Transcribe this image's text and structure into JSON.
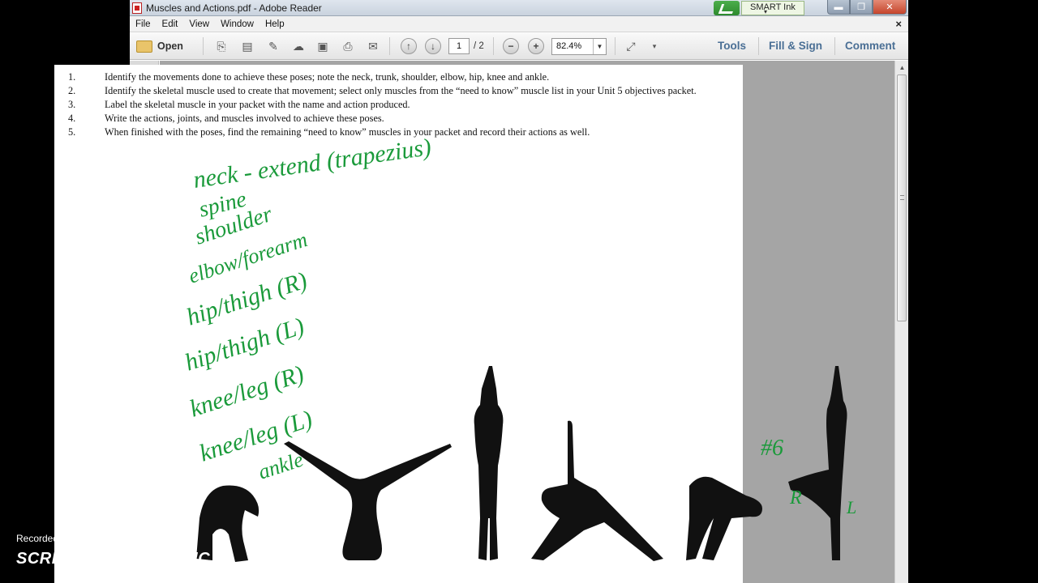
{
  "window": {
    "title": "Muscles and Actions.pdf - Adobe Reader",
    "smart_ink": "SMART Ink",
    "buttons": {
      "minimize": "▬",
      "restore": "❐",
      "close": "✕"
    }
  },
  "menu": {
    "items": [
      "File",
      "Edit",
      "View",
      "Window",
      "Help"
    ],
    "close": "×"
  },
  "toolbar": {
    "open_label": "Open",
    "page_current": "1",
    "page_total": "/ 2",
    "zoom": "82.4%",
    "tools": "Tools",
    "fill_sign": "Fill & Sign",
    "comment": "Comment"
  },
  "document": {
    "instructions": [
      {
        "num": "1.",
        "text": "Identify the movements done to achieve these poses; note the neck, trunk, shoulder, elbow, hip, knee and ankle."
      },
      {
        "num": "2.",
        "text": "Identify the skeletal muscle used to create that movement; select only muscles from the “need to know” muscle list in your Unit 5 objectives packet."
      },
      {
        "num": "3.",
        "text": "Label the skeletal muscle in your packet with the name and action produced."
      },
      {
        "num": "4.",
        "text": "Write the actions, joints, and muscles involved to achieve these poses."
      },
      {
        "num": "5.",
        "text": "When finished with the poses, find the remaining “need to know” muscles in your packet and record their actions as well."
      }
    ],
    "handwriting": {
      "header": "neck - extend (trapezius)",
      "list": [
        "spine",
        "shoulder",
        "elbow/forearm",
        "hip/thigh (R)",
        "hip/thigh (L)",
        "knee/leg (R)",
        "knee/leg (L)",
        "ankle"
      ],
      "pose_number": "#6",
      "right_mark": "R",
      "left_mark": "L"
    },
    "ink_color": "#1a9a3a"
  },
  "watermark": {
    "recorded_with": "Recorded with",
    "brand_left": "SCREENCAST",
    "brand_right": "MATIC"
  }
}
